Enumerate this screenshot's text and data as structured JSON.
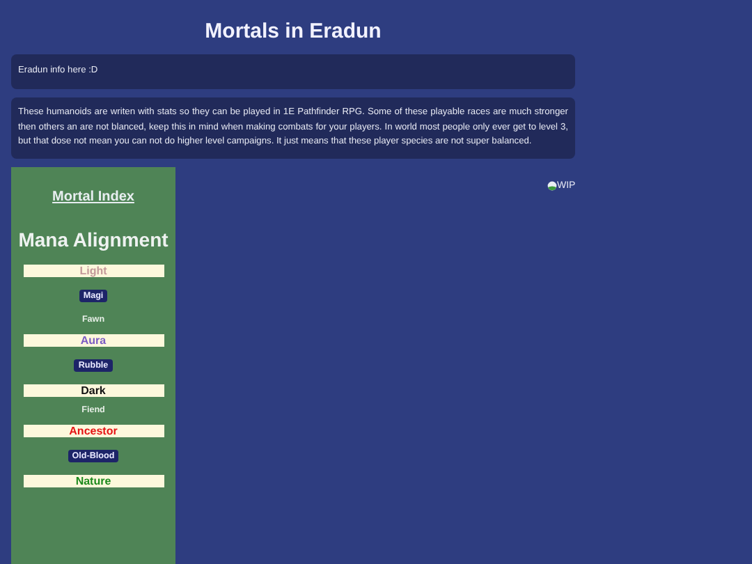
{
  "title": "Mortals in Eradun",
  "info": "Eradun info here :D",
  "description": "These humanoids are writen with stats so they can be played in 1E Pathfinder RPG. Some of these playable races are much stronger then others an are not blanced, keep this in mind when making combats for your players. In world most people only ever get to level 3, but that dose not mean you can not do higher level campaigns. It just means that these player species are not super balanced.",
  "sidebar": {
    "index_link": "Mortal Index",
    "heading": "Mana Alignment",
    "items": [
      {
        "kind": "group",
        "label": "Light",
        "color": "#c49a9a"
      },
      {
        "kind": "badge",
        "label": "Magi"
      },
      {
        "kind": "plain",
        "label": "Fawn"
      },
      {
        "kind": "group",
        "label": "Aura",
        "color": "#7b5cc4"
      },
      {
        "kind": "badge",
        "label": "Rubble"
      },
      {
        "kind": "group",
        "label": "Dark",
        "color": "#111111"
      },
      {
        "kind": "plain",
        "label": "Fiend"
      },
      {
        "kind": "group",
        "label": "Ancestor",
        "color": "#e51414"
      },
      {
        "kind": "badge",
        "label": "Old-Blood"
      },
      {
        "kind": "group",
        "label": "Nature",
        "color": "#1d8a1d"
      }
    ]
  },
  "image_alt": "WIP"
}
